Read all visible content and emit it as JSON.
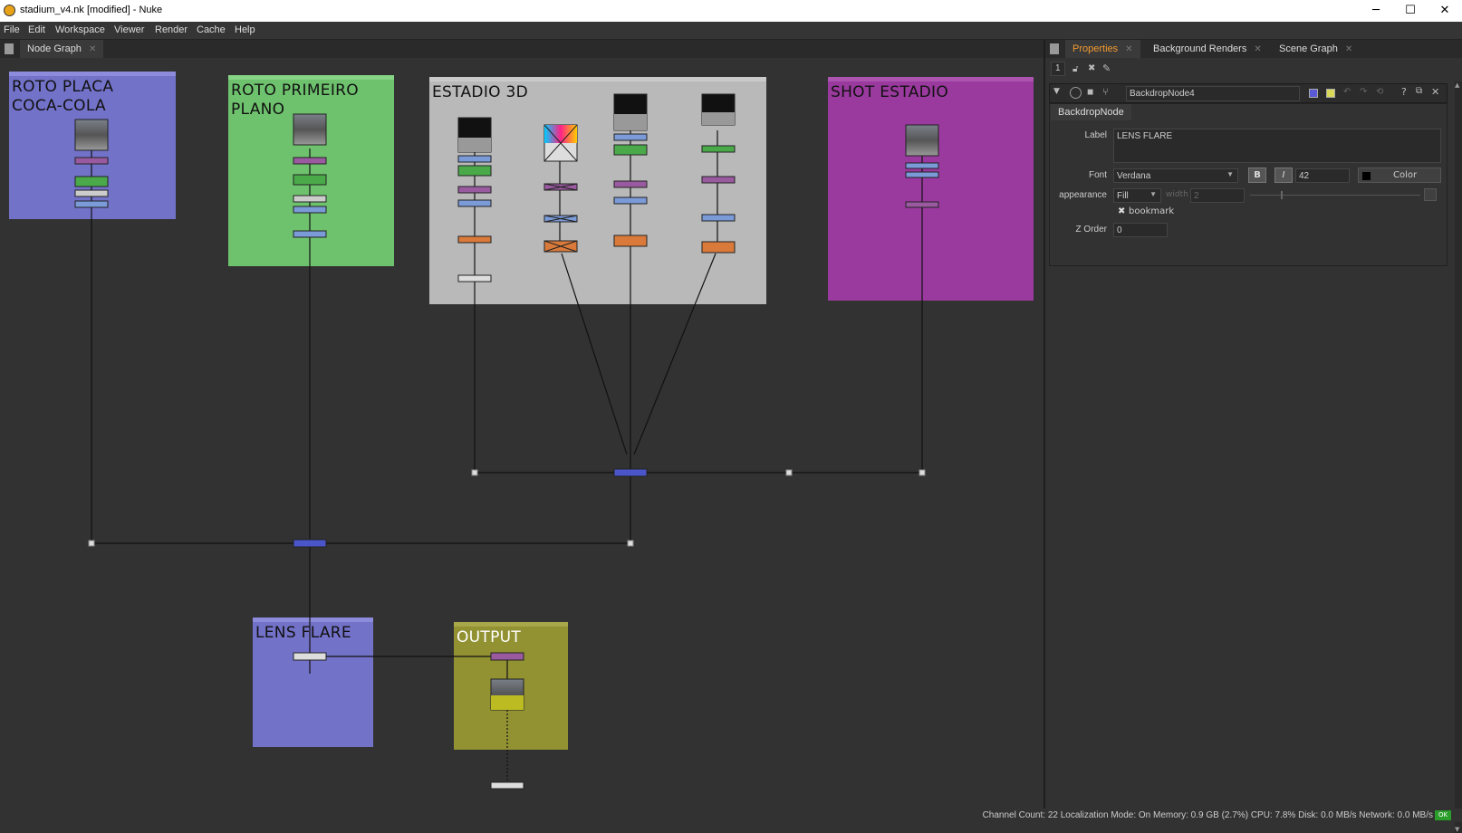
{
  "window": {
    "title": "stadium_v4.nk [modified] - Nuke",
    "minimize": "─",
    "maximize": "☐",
    "close": "✕"
  },
  "menu": [
    "File",
    "Edit",
    "Workspace",
    "Viewer",
    "Render",
    "Cache",
    "Help"
  ],
  "graph_tab": {
    "label": "Node Graph",
    "close": "✕"
  },
  "backdrops": [
    {
      "label": "ROTO PLACA\nCOCA-COLA",
      "color": "#7372c9"
    },
    {
      "label": "ROTO PRIMEIRO\nPLANO",
      "color": "#6ec26e"
    },
    {
      "label": "ESTADIO 3D",
      "color": "#b9b9b9"
    },
    {
      "label": "SHOT ESTADIO",
      "color": "#9a3a9e"
    },
    {
      "label": "LENS FLARE",
      "color": "#7372c9"
    },
    {
      "label": "OUTPUT",
      "color": "#929233"
    }
  ],
  "properties": {
    "tabs": [
      {
        "label": "Properties",
        "close": "✕"
      },
      {
        "label": "Background Renders",
        "close": "✕"
      },
      {
        "label": "Scene Graph",
        "close": "✕"
      }
    ],
    "panel_count": "1",
    "node_name": "BackdropNode4",
    "node_class_tab": "BackdropNode",
    "label_caption": "Label",
    "label_value": "LENS FLARE",
    "font_caption": "Font",
    "font_value": "Verdana",
    "bold_btn": "B",
    "italic_btn": "I",
    "font_size": "42",
    "color_btn": "Color",
    "appearance_caption": "appearance",
    "appearance_value": "Fill",
    "width_caption": "width",
    "width_value": "2",
    "bookmark_label": "bookmark",
    "bookmark_checked": true,
    "zorder_caption": "Z Order",
    "zorder_value": "0",
    "help_btn": "?"
  },
  "status": {
    "text": "Channel Count: 22  Localization Mode: On  Memory: 0.9 GB (2.7%)  CPU: 7.8%  Disk: 0.0 MB/s  Network: 0.0 MB/s",
    "ok": "OK"
  }
}
